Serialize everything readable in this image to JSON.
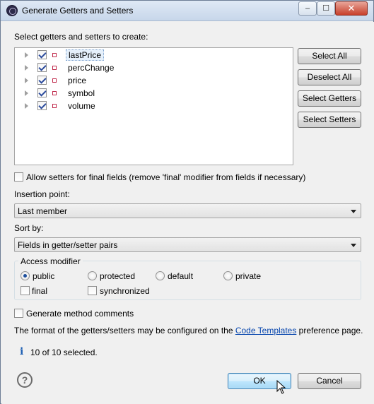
{
  "window": {
    "title": "Generate Getters and Setters",
    "controls": {
      "minimize": "–",
      "maximize": "☐",
      "close": "✕"
    }
  },
  "prompt": "Select getters and setters to create:",
  "fields": [
    {
      "label": "lastPrice",
      "checked": true,
      "selected": true
    },
    {
      "label": "percChange",
      "checked": true,
      "selected": false
    },
    {
      "label": "price",
      "checked": true,
      "selected": false
    },
    {
      "label": "symbol",
      "checked": true,
      "selected": false
    },
    {
      "label": "volume",
      "checked": true,
      "selected": false
    }
  ],
  "side_buttons": {
    "select_all": "Select All",
    "deselect_all": "Deselect All",
    "select_getters": "Select Getters",
    "select_setters": "Select Setters"
  },
  "allow_setters": {
    "label": "Allow setters for final fields (remove 'final' modifier from fields if necessary)",
    "checked": false
  },
  "insertion_point": {
    "label": "Insertion point:",
    "value": "Last member"
  },
  "sort_by": {
    "label": "Sort by:",
    "value": "Fields in getter/setter pairs"
  },
  "access_modifier": {
    "title": "Access modifier",
    "options": [
      {
        "label": "public",
        "checked": true
      },
      {
        "label": "protected",
        "checked": false
      },
      {
        "label": "default",
        "checked": false
      },
      {
        "label": "private",
        "checked": false
      }
    ],
    "final": {
      "label": "final",
      "checked": false
    },
    "synchronized": {
      "label": "synchronized",
      "checked": false
    }
  },
  "generate_comments": {
    "label": "Generate method comments",
    "checked": false
  },
  "config_text": {
    "before": "The format of the getters/setters may be configured on the ",
    "link": "Code Templates",
    "after": " preference page."
  },
  "status": {
    "icon": "info-icon",
    "text": "10 of 10 selected."
  },
  "footer": {
    "ok": "OK",
    "cancel": "Cancel",
    "help_icon": "help-icon"
  }
}
